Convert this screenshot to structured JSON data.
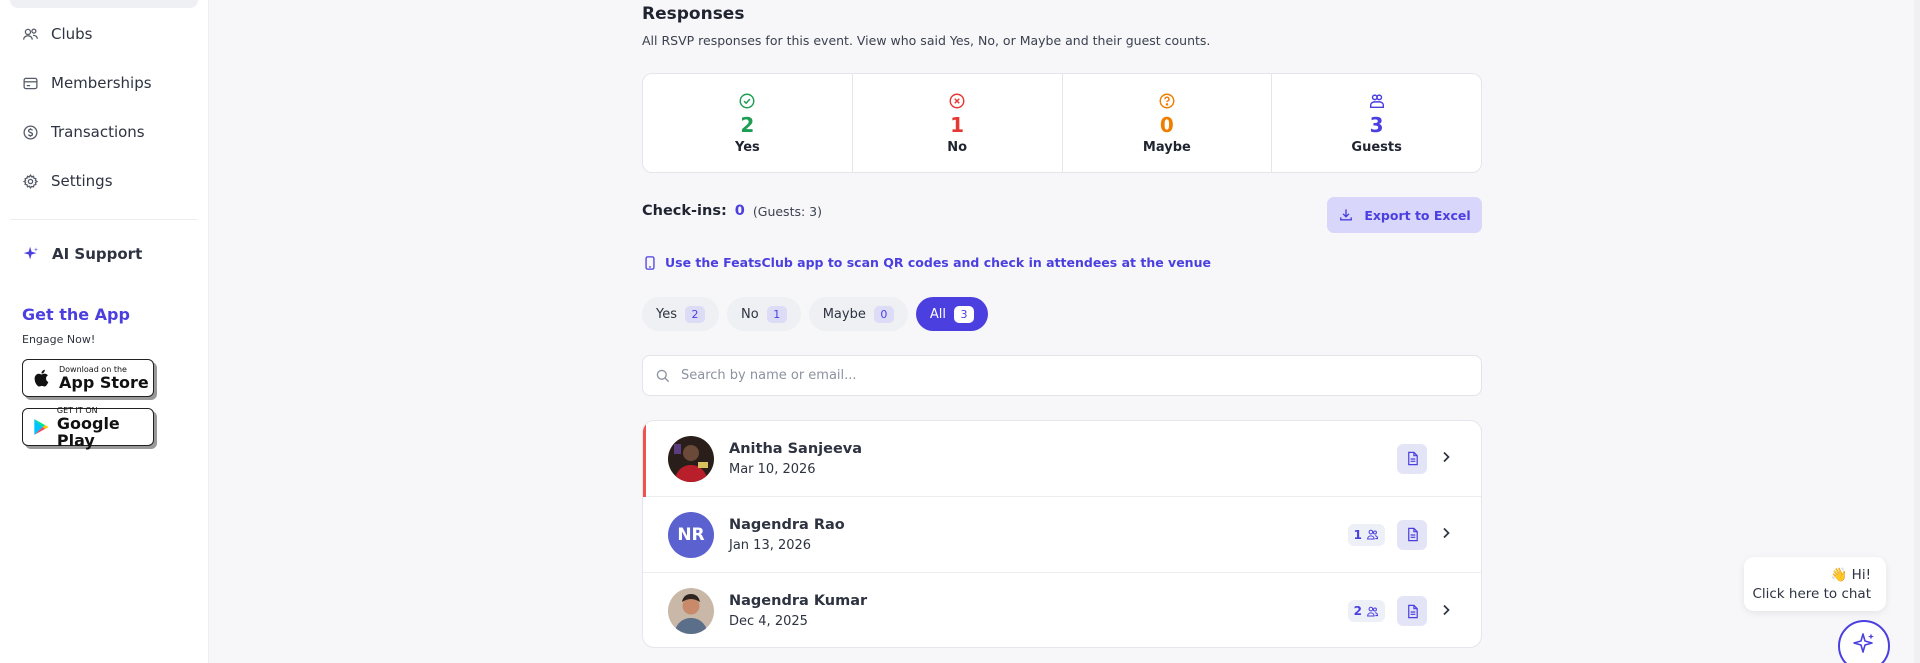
{
  "sidebar": {
    "items": [
      {
        "label": "Clubs",
        "icon": "users-icon"
      },
      {
        "label": "Memberships",
        "icon": "card-icon"
      },
      {
        "label": "Transactions",
        "icon": "dollar-circle-icon"
      },
      {
        "label": "Settings",
        "icon": "gear-icon"
      }
    ],
    "ai_support": "AI Support",
    "get_app_title": "Get the App",
    "get_app_sub": "Engage Now!",
    "app_store": {
      "small": "Download on the",
      "big": "App Store"
    },
    "google_play": {
      "small": "GET IT ON",
      "big": "Google Play"
    }
  },
  "responses": {
    "title": "Responses",
    "subtitle": "All RSVP responses for this event. View who said Yes, No, or Maybe and their guest counts.",
    "stats": [
      {
        "value": "2",
        "label": "Yes",
        "color": "#1f9d55",
        "icon": "check-circle-icon"
      },
      {
        "value": "1",
        "label": "No",
        "color": "#e53935",
        "icon": "x-circle-icon"
      },
      {
        "value": "0",
        "label": "Maybe",
        "color": "#ef7d00",
        "icon": "question-circle-icon"
      },
      {
        "value": "3",
        "label": "Guests",
        "color": "#4b3fe0",
        "icon": "guests-icon"
      }
    ]
  },
  "checkins": {
    "label": "Check-ins:",
    "count": "0",
    "guests": "(Guests: 3)"
  },
  "export_label": "Export to Excel",
  "qr_note": "Use the FeatsClub app to scan QR codes and check in attendees at the venue",
  "filters": [
    {
      "label": "Yes",
      "count": "2",
      "active": false
    },
    {
      "label": "No",
      "count": "1",
      "active": false
    },
    {
      "label": "Maybe",
      "count": "0",
      "active": false
    },
    {
      "label": "All",
      "count": "3",
      "active": true
    }
  ],
  "search": {
    "placeholder": "Search by name or email..."
  },
  "attendees": [
    {
      "name": "Anitha Sanjeeva",
      "date": "Mar 10, 2026",
      "guests": ""
    },
    {
      "name": "Nagendra Rao",
      "date": "Jan 13, 2026",
      "initials": "NR",
      "guests": "1"
    },
    {
      "name": "Nagendra Kumar",
      "date": "Dec 4, 2025",
      "guests": "2"
    }
  ],
  "chat": {
    "greeting": "👋 Hi!",
    "cta": "Click here to chat"
  }
}
